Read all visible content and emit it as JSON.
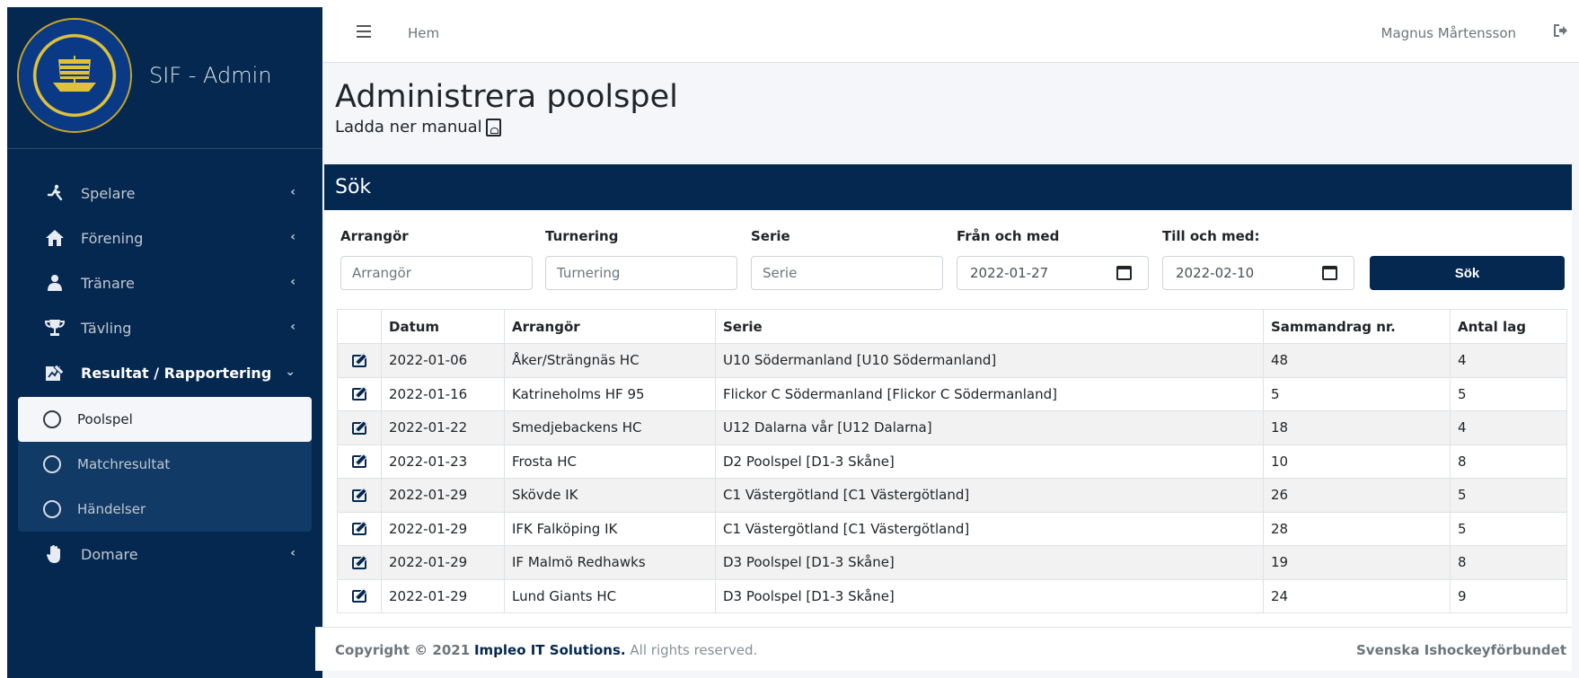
{
  "brand": {
    "title": "SIF - Admin",
    "logo_icon": "sif-crest-icon"
  },
  "sidebar": {
    "items": [
      {
        "label": "Spelare",
        "icon": "skater-icon"
      },
      {
        "label": "Förening",
        "icon": "house-icon"
      },
      {
        "label": "Tränare",
        "icon": "coach-icon"
      },
      {
        "label": "Tävling",
        "icon": "trophy-icon"
      },
      {
        "label": "Resultat / Rapportering",
        "icon": "report-icon"
      },
      {
        "label": "Domare",
        "icon": "hand-icon"
      }
    ],
    "subitems": [
      {
        "label": "Poolspel"
      },
      {
        "label": "Matchresultat"
      },
      {
        "label": "Händelser"
      }
    ]
  },
  "topbar": {
    "breadcrumb": "Hem",
    "user": "Magnus Mårtensson"
  },
  "page": {
    "title": "Administrera poolspel",
    "manual_link": "Ladda ner manual"
  },
  "search": {
    "header": "Sök",
    "fields": {
      "arrangor": {
        "label": "Arrangör",
        "placeholder": "Arrangör"
      },
      "turnering": {
        "label": "Turnering",
        "placeholder": "Turnering"
      },
      "serie": {
        "label": "Serie",
        "placeholder": "Serie"
      },
      "from": {
        "label": "Från och med",
        "value": "2022-01-27"
      },
      "to": {
        "label": "Till och med:",
        "value": "2022-02-10"
      }
    },
    "button": "Sök"
  },
  "table": {
    "headers": [
      "",
      "Datum",
      "Arrangör",
      "Serie",
      "Sammandrag nr.",
      "Antal lag"
    ],
    "rows": [
      [
        "2022-01-06",
        "Åker/Strängnäs HC",
        "U10 Södermanland [U10 Södermanland]",
        "48",
        "4"
      ],
      [
        "2022-01-16",
        "Katrineholms HF 95",
        "Flickor C Södermanland [Flickor C Södermanland]",
        "5",
        "5"
      ],
      [
        "2022-01-22",
        "Smedjebackens HC",
        "U12 Dalarna vår [U12 Dalarna]",
        "18",
        "4"
      ],
      [
        "2022-01-23",
        "Frosta HC",
        "D2 Poolspel [D1-3 Skåne]",
        "10",
        "8"
      ],
      [
        "2022-01-29",
        "Skövde IK",
        "C1 Västergötland [C1 Västergötland]",
        "26",
        "5"
      ],
      [
        "2022-01-29",
        "IFK Falköping IK",
        "C1 Västergötland [C1 Västergötland]",
        "28",
        "5"
      ],
      [
        "2022-01-29",
        "IF Malmö Redhawks",
        "D3 Poolspel [D1-3 Skåne]",
        "19",
        "8"
      ],
      [
        "2022-01-29",
        "Lund Giants HC",
        "D3 Poolspel [D1-3 Skåne]",
        "24",
        "9"
      ]
    ]
  },
  "footer": {
    "copyright_prefix": "Copyright © 2021",
    "company": "Impleo IT Solutions.",
    "rights": "All rights reserved.",
    "right_text": "Svenska Ishockeyförbundet"
  }
}
